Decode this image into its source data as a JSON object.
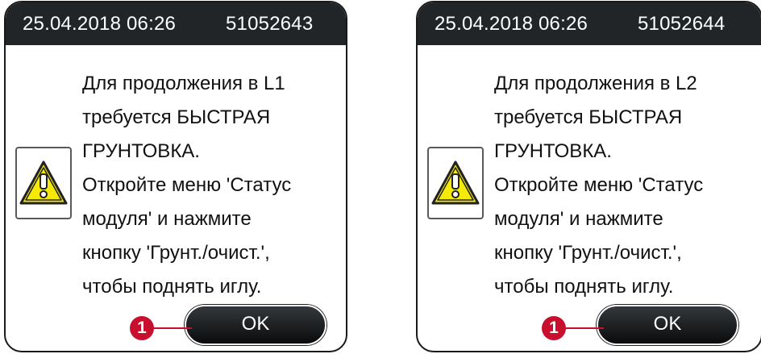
{
  "dialogs": [
    {
      "timestamp": "25.04.2018 06:26",
      "message_id": "51052643",
      "icon": "warning-triangle-icon",
      "lines": [
        "Для продолжения в L1",
        "требуется БЫСТРАЯ",
        "ГРУНТОВКА.",
        "Откройте меню 'Статус",
        "модуля' и нажмите",
        "кнопку 'Грунт./очист.',",
        "чтобы поднять иглу."
      ],
      "ok_label": "OK",
      "callout_number": "1"
    },
    {
      "timestamp": "25.04.2018 06:26",
      "message_id": "51052644",
      "icon": "warning-triangle-icon",
      "lines": [
        "Для продолжения в L2",
        "требуется БЫСТРАЯ",
        "ГРУНТОВКА.",
        "Откройте меню 'Статус",
        "модуля' и нажмите",
        "кнопку 'Грунт./очист.',",
        "чтобы поднять иглу."
      ],
      "ok_label": "OK",
      "callout_number": "1"
    }
  ],
  "colors": {
    "header_bg": "#222528",
    "warning_yellow": "#f5e90a",
    "callout_red": "#c8102e"
  }
}
